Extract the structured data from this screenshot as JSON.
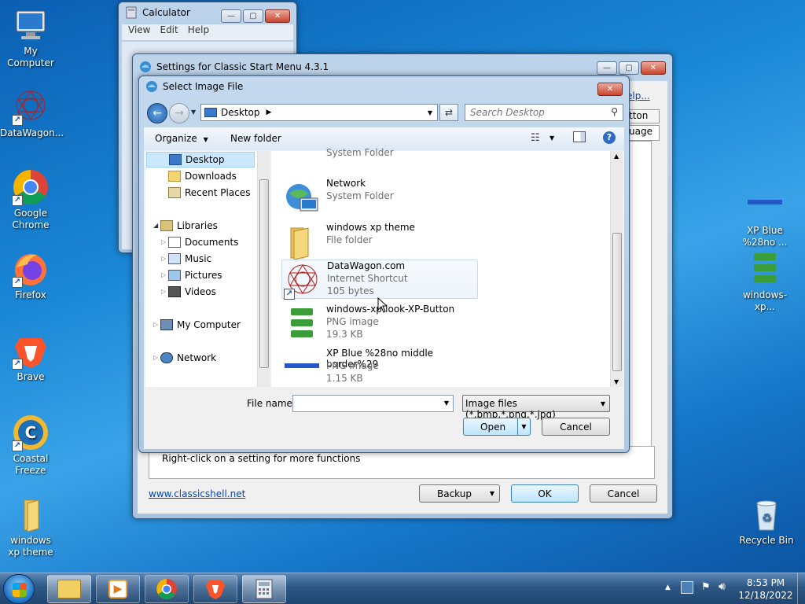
{
  "desktop": {
    "icons": [
      {
        "label": "My Computer",
        "icon": "computer-icon"
      },
      {
        "label": "DataWagon...",
        "icon": "datawagon-icon"
      },
      {
        "label": "Google Chrome",
        "icon": "chrome-icon"
      },
      {
        "label": "Firefox",
        "icon": "firefox-icon"
      },
      {
        "label": "Brave",
        "icon": "brave-icon"
      },
      {
        "label": "Coastal Freeze",
        "icon": "coastal-freeze-icon"
      },
      {
        "label": "windows xp theme",
        "icon": "folder-icon"
      },
      {
        "label": "XP Blue %28no ...",
        "icon": "png-image-icon"
      },
      {
        "label": "windows-xp...",
        "icon": "png-image-icon"
      },
      {
        "label": "Recycle Bin",
        "icon": "recycle-bin-icon"
      }
    ]
  },
  "calculator": {
    "title": "Calculator",
    "menu": [
      "View",
      "Edit",
      "Help"
    ]
  },
  "settings": {
    "title": "Settings for Classic Start Menu 4.3.1",
    "help_link": "elp...",
    "tab_partial_1": "tton",
    "tab_partial_2": "uage",
    "status_text": "Right-click on a setting for more functions",
    "website_link": "www.classicshell.net",
    "backup_label": "Backup",
    "ok_label": "OK",
    "cancel_label": "Cancel"
  },
  "dialog": {
    "title": "Select Image File",
    "address": "Desktop",
    "search_placeholder": "Search Desktop",
    "organize_label": "Organize",
    "new_folder_label": "New folder",
    "nav": {
      "desktop": "Desktop",
      "downloads": "Downloads",
      "recent_places": "Recent Places",
      "libraries": "Libraries",
      "documents": "Documents",
      "music": "Music",
      "pictures": "Pictures",
      "videos": "Videos",
      "my_computer": "My Computer",
      "network": "Network"
    },
    "files": [
      {
        "name": "",
        "type": "System Folder",
        "size": ""
      },
      {
        "name": "Network",
        "type": "System Folder",
        "size": ""
      },
      {
        "name": "windows xp theme",
        "type": "File folder",
        "size": ""
      },
      {
        "name": "DataWagon.com",
        "type": "Internet Shortcut",
        "size": "105 bytes"
      },
      {
        "name": "windows-xp-look-XP-Button",
        "type": "PNG image",
        "size": "19.3 KB"
      },
      {
        "name": "XP Blue %28no middle border%29",
        "type": "PNG image",
        "size": "1.15 KB"
      }
    ],
    "filename_label": "File name:",
    "filename_value": "",
    "filter_value": "Image files (*.bmp,*.png,*.jpg)",
    "open_label": "Open",
    "cancel_label": "Cancel"
  },
  "taskbar": {
    "time": "8:53 PM",
    "date": "12/18/2022"
  }
}
